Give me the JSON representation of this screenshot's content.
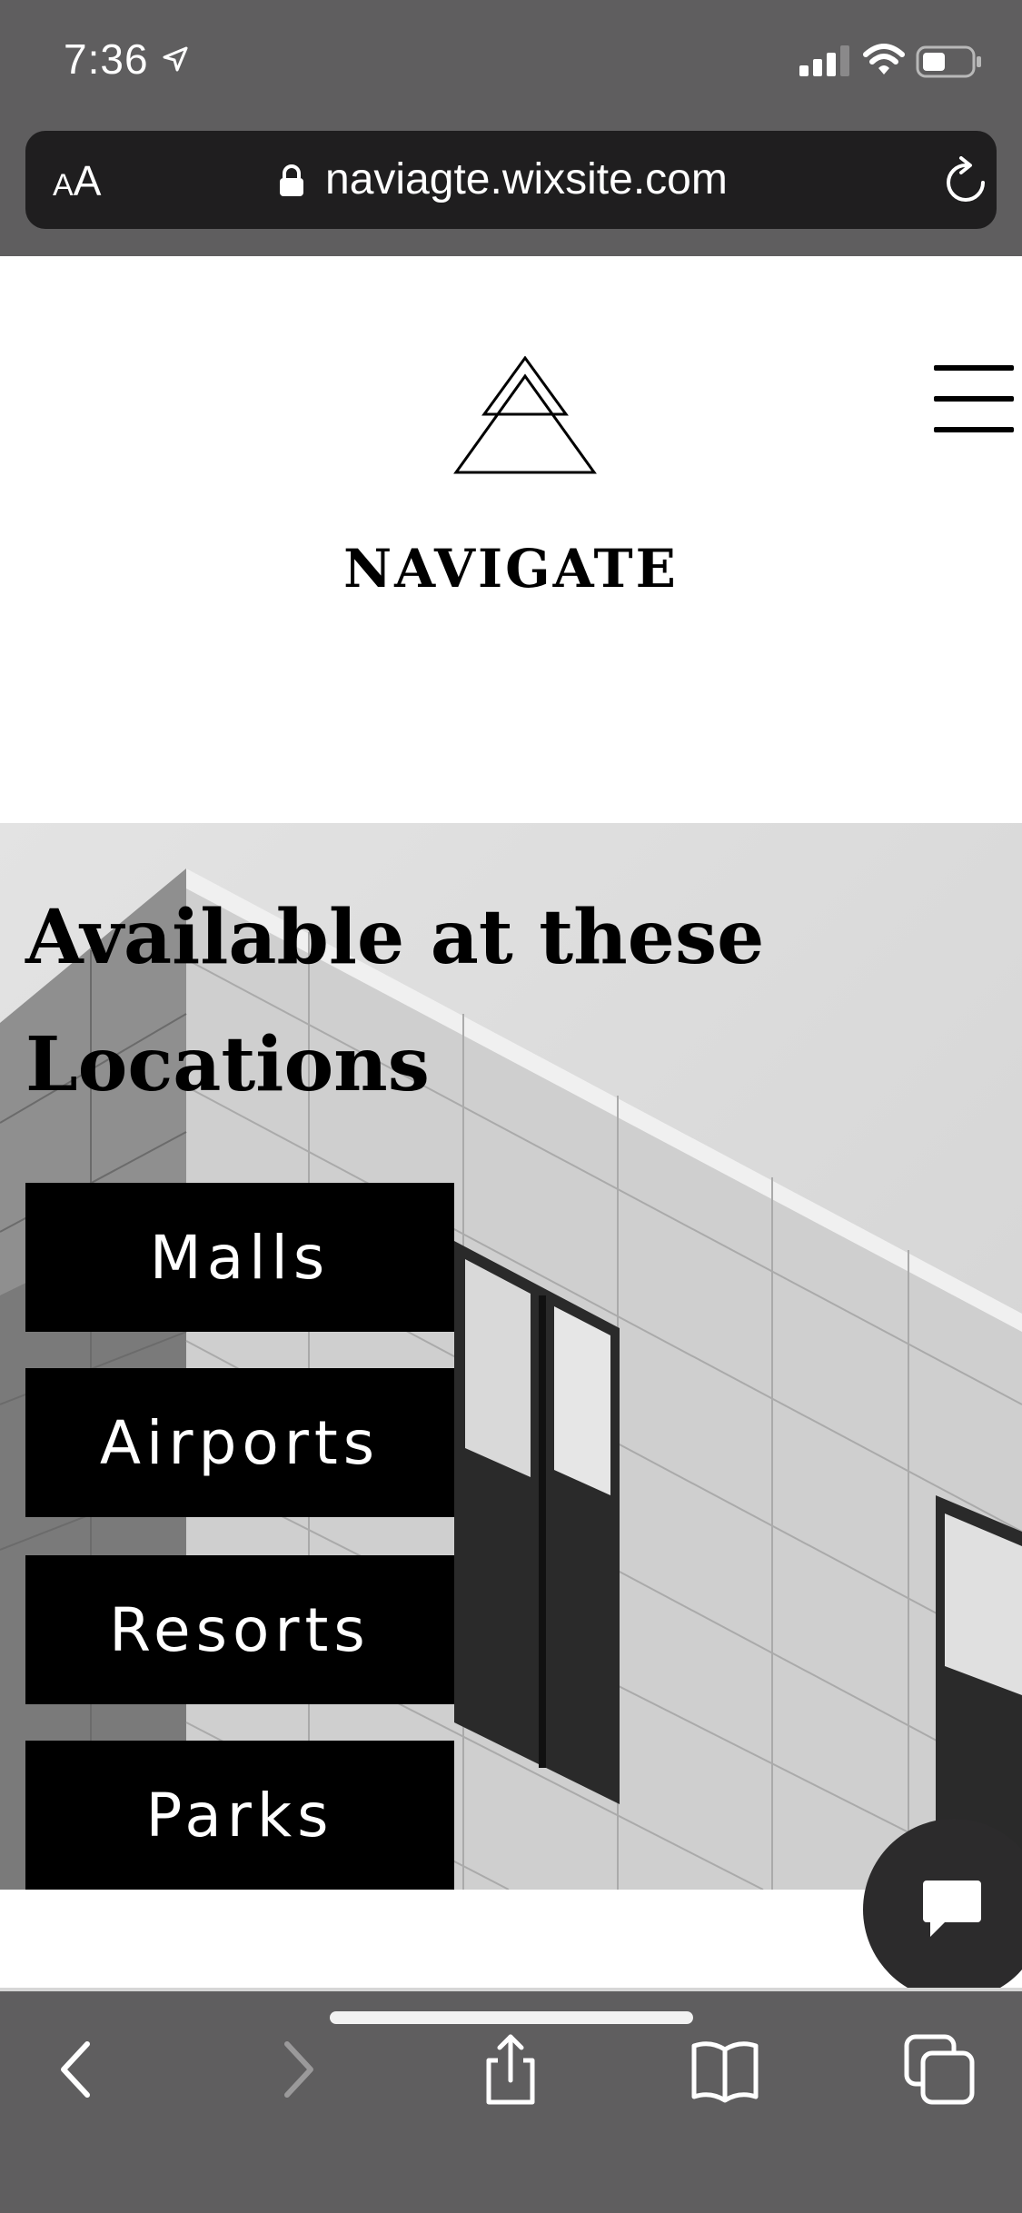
{
  "status_bar": {
    "time": "7:36",
    "icons": [
      "location-arrow-icon",
      "signal-icon",
      "wifi-icon",
      "battery-icon"
    ]
  },
  "browser": {
    "aa_small": "A",
    "aa_big": "A",
    "url": "naviagte.wixsite.com",
    "icons": [
      "lock-icon",
      "reload-icon"
    ]
  },
  "site": {
    "brand": "NAVIGATE",
    "menu_icon": "hamburger-icon",
    "logo_icon": "triangle-logo-icon"
  },
  "hero": {
    "title": "Available at these Locations",
    "buttons": [
      "Malls",
      "Airports",
      "Resorts",
      "Parks"
    ]
  },
  "chat": {
    "icon": "chat-icon"
  },
  "toolbar": {
    "items": [
      "back-icon",
      "forward-icon",
      "share-icon",
      "bookmarks-icon",
      "tabs-icon"
    ]
  },
  "colors": {
    "chrome": "#5f5e5f",
    "url_bar": "#1f1e1f",
    "button_bg": "#000000",
    "button_text": "#ffffff",
    "chat_bubble": "#2c2b2c"
  }
}
